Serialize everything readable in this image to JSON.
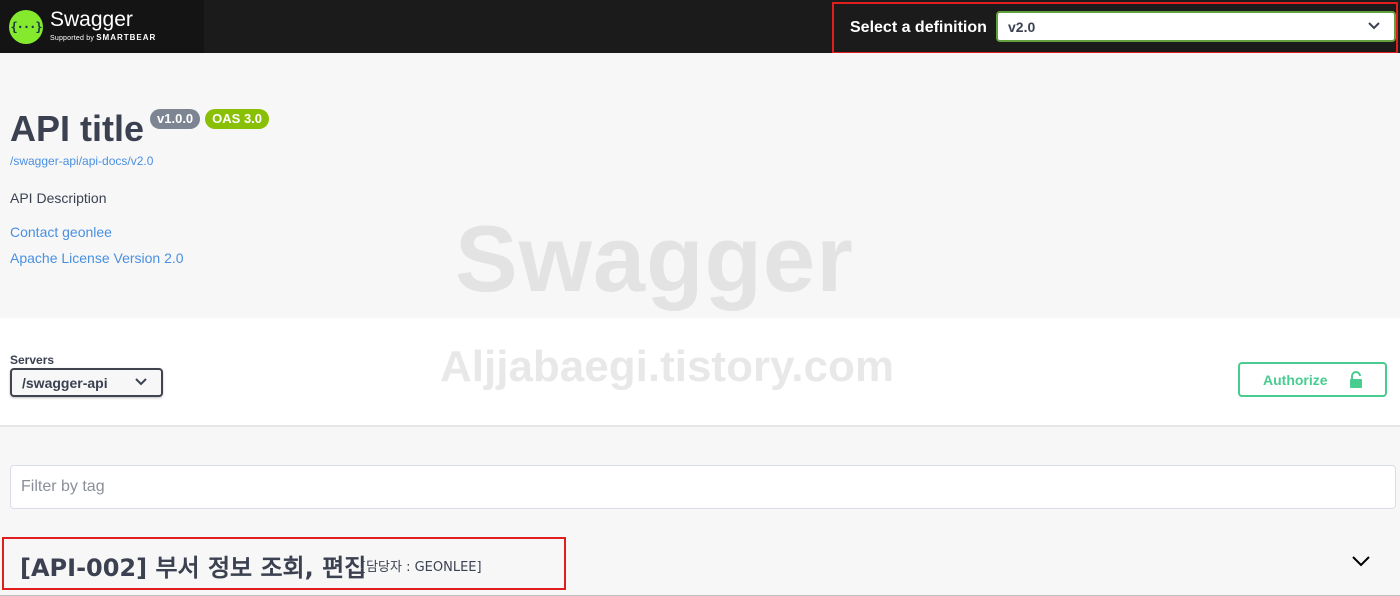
{
  "topbar": {
    "brand_name": "Swagger",
    "brand_sub_prefix": "Supported by",
    "brand_sub_company": "SMARTBEAR",
    "logo_glyph": "{···}",
    "definition_label": "Select a definition",
    "definition_selected": "v2.0"
  },
  "info": {
    "title": "API title",
    "version_badge": "v1.0.0",
    "oas_badge": "OAS 3.0",
    "url": "/swagger-api/api-docs/v2.0",
    "description": "API Description",
    "contact": "Contact geonlee",
    "license": "Apache License Version 2.0"
  },
  "watermark": {
    "line1": "Swagger",
    "line2": "Aljjabaegi.tistory.com"
  },
  "servers": {
    "label": "Servers",
    "selected": "/swagger-api"
  },
  "authorize": {
    "label": "Authorize"
  },
  "filter": {
    "placeholder": "Filter by tag"
  },
  "tag": {
    "name": "[API-002] 부서 정보 조회, 편집",
    "description": "[담당자 : GEONLEE]"
  },
  "colors": {
    "topbar_bg": "#1b1b1b",
    "logo_green": "#85ea2d",
    "select_border": "#62a03f",
    "highlight_red": "#e01e1e",
    "link_blue": "#4990e2",
    "badge_gray": "#7d8492",
    "badge_green": "#89bf04",
    "authorize_green": "#49cc90",
    "text_dark": "#3b4151"
  },
  "icons": [
    "swagger-logo-icon",
    "chevron-down-icon",
    "lock-icon"
  ]
}
